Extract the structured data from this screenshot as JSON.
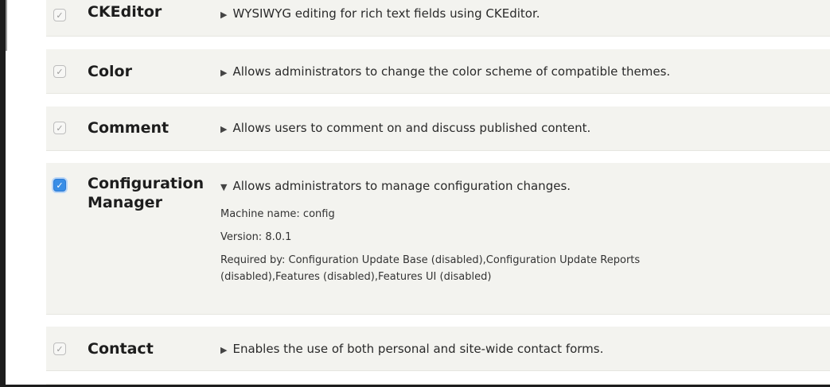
{
  "modules": [
    {
      "name": "CKEditor",
      "description": "WYSIWYG editing for rich text fields using CKEditor.",
      "checked": true
    },
    {
      "name": "Color",
      "description": "Allows administrators to change the color scheme of compatible themes.",
      "checked": true
    },
    {
      "name": "Comment",
      "description": "Allows users to comment on and discuss published content.",
      "checked": true
    },
    {
      "name_line1": "Configuration",
      "name_line2": "Manager",
      "description": "Allows administrators to manage configuration changes.",
      "checked": true,
      "expanded": true,
      "machine_name": "Machine name: config",
      "version": "Version: 8.0.1",
      "required_by_line1": "Required by: Configuration Update Base (disabled),Configuration Update Reports",
      "required_by_line2": "(disabled),Features (disabled),Features UI (disabled)"
    },
    {
      "name": "Contact",
      "description": "Enables the use of both personal and site-wide contact forms.",
      "checked": true
    }
  ],
  "icons": {
    "collapsed": "▶",
    "expanded": "▼",
    "check": "✓"
  },
  "colors": {
    "row_bg": "#f3f3ef",
    "checkbox_active": "#3a8ee6"
  }
}
